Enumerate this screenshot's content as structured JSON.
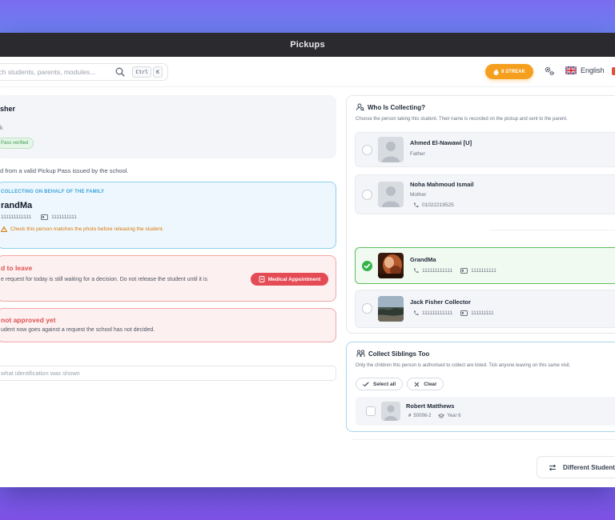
{
  "window": {
    "title": "Pickups"
  },
  "topbar": {
    "search_placeholder": "arch students, parents, modules...",
    "kbd_ctrl": "Ctrl",
    "kbd_k": "K",
    "streak_label": "8 STREAK",
    "language": "English"
  },
  "left": {
    "collector_name": "sher",
    "mark": "k",
    "pass_badge": "Pass verified",
    "valid_note": "d from a valid Pickup Pass issued by the school.",
    "behalf_label": "COLLECTING ON BEHALF OF THE FAMILY",
    "behalf_name": "randMa",
    "behalf_phone": "111111111111",
    "behalf_id": "1111111111",
    "warning": "Check this person matches the photo before releasing the student.",
    "leave_title": "d to leave",
    "leave_text": "e request for today is still waiting for a decision. Do not release the student until it is",
    "medical_button": "Medical Appointment",
    "notapproved_title": "not approved yet",
    "notapproved_text": "udent now goes against a request the school has not decided.",
    "id_placeholder": "what identification was shown"
  },
  "who": {
    "title": "Who Is Collecting?",
    "subtitle": "Choose the person taking this student. Their name is recorded on the pickup and sent to the parent.",
    "people": [
      {
        "name": "Ahmed El-Nawawi [U]",
        "sub": "Father"
      },
      {
        "name": "Noha Mahmoud Ismail",
        "sub": "Mother",
        "phone": "01022219525"
      },
      {
        "name": "GrandMa",
        "phone": "111111111111",
        "id": "1111111111"
      },
      {
        "name": "Jack Fisher Collector",
        "phone": "111111111111",
        "id": "111111111"
      }
    ]
  },
  "siblings": {
    "title": "Collect Siblings Too",
    "subtitle": "Only the children this person is authorised to collect are listed. Tick anyone leaving on this same visit.",
    "select_all": "Select all",
    "clear": "Clear",
    "rows": [
      {
        "name": "Robert Matthews",
        "code": "50096-2",
        "year": "Year 6"
      }
    ]
  },
  "footer": {
    "different_student": "Different Student"
  },
  "colors": {
    "accent_green": "#35b34a",
    "streak_orange": "#f59f1f",
    "danger_red": "#e54b55",
    "info_blue": "#3aa3dc"
  }
}
